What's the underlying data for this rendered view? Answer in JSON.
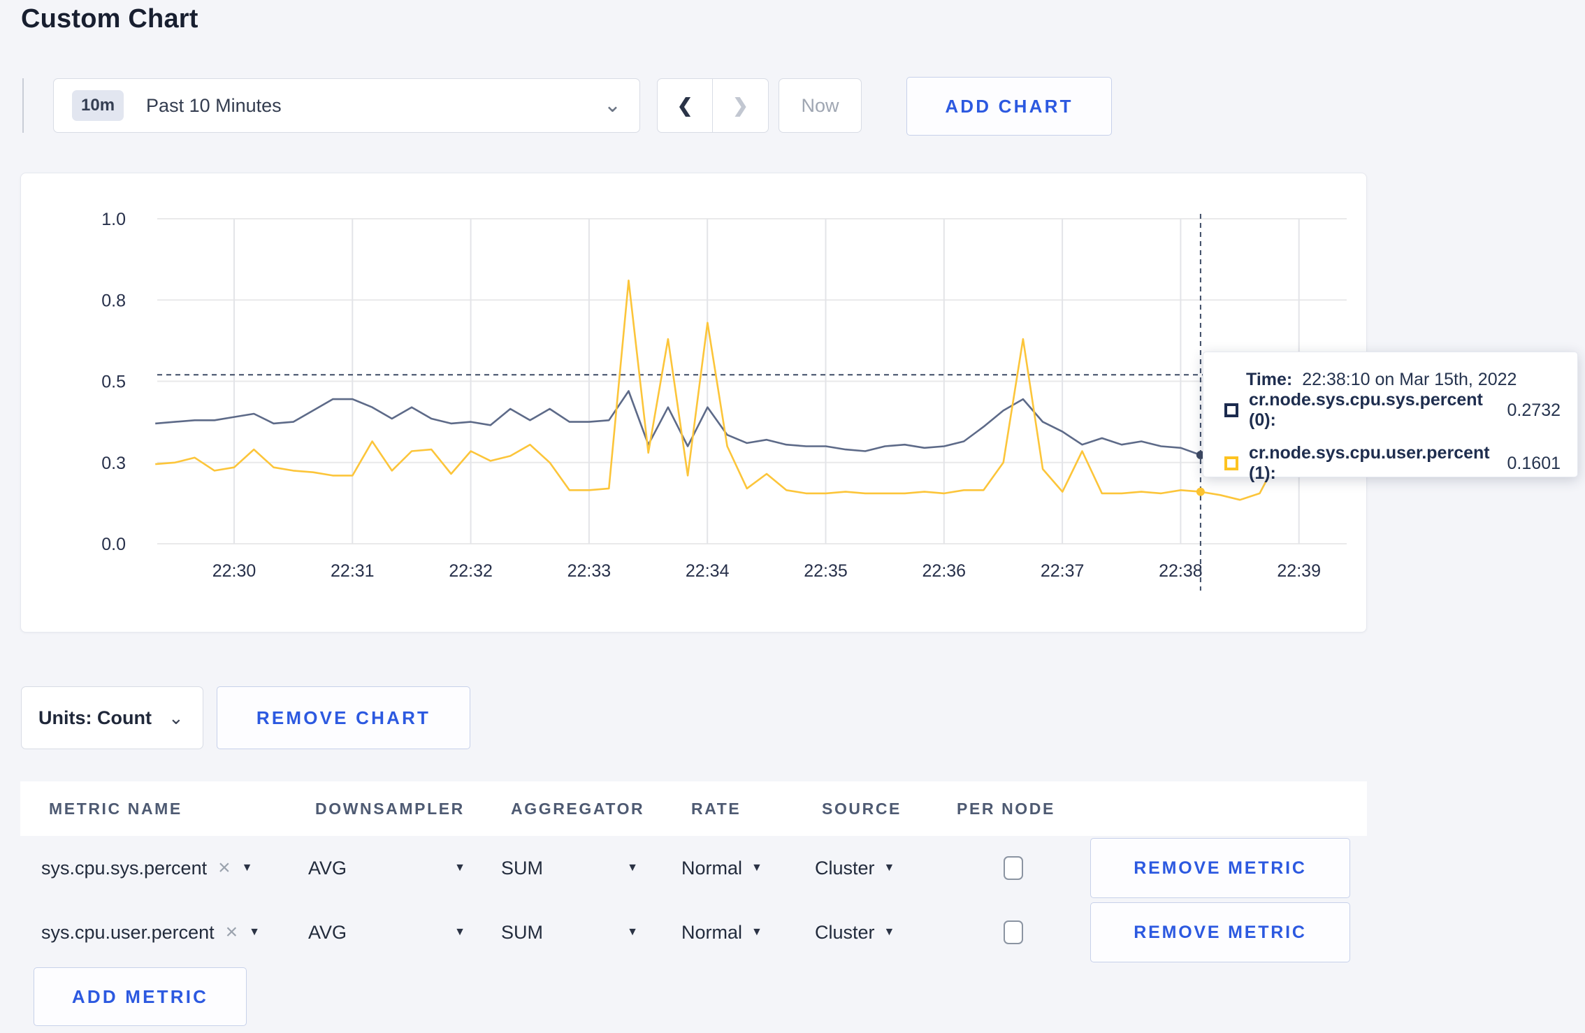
{
  "page_title": "Custom Chart",
  "icons": {
    "chevron_down": "⌄",
    "chevron_left": "❮",
    "chevron_right": "❯",
    "caret_down": "▼",
    "close": "×"
  },
  "toolbar": {
    "time_scale_badge": "10m",
    "time_scale_label": "Past 10 Minutes",
    "now_label": "Now",
    "add_chart_label": "ADD CHART"
  },
  "chart_data": {
    "type": "line",
    "title": "",
    "xlabel": "",
    "ylabel": "",
    "ylim": [
      0,
      1
    ],
    "grid": true,
    "legend_position": "tooltip",
    "y_ticks": [
      {
        "value": 0,
        "label": "0.0"
      },
      {
        "value": 0.25,
        "label": "0.3"
      },
      {
        "value": 0.5,
        "label": "0.5"
      },
      {
        "value": 0.75,
        "label": "0.8"
      },
      {
        "value": 1,
        "label": "1.0"
      }
    ],
    "x_ticks": [
      "22:30",
      "22:31",
      "22:32",
      "22:33",
      "22:34",
      "22:35",
      "22:36",
      "22:37",
      "22:38",
      "22:39"
    ],
    "x_start": "22:29:20",
    "x_interval_seconds": 10,
    "series": [
      {
        "name": "cr.node.sys.cpu.sys.percent (0)",
        "color": "#5d6a88",
        "dot_color": "#3d4963",
        "values": [
          0.37,
          0.375,
          0.38,
          0.38,
          0.39,
          0.4,
          0.37,
          0.375,
          0.41,
          0.445,
          0.445,
          0.42,
          0.385,
          0.42,
          0.385,
          0.37,
          0.375,
          0.365,
          0.415,
          0.38,
          0.415,
          0.375,
          0.375,
          0.38,
          0.47,
          0.305,
          0.42,
          0.3,
          0.42,
          0.335,
          0.31,
          0.32,
          0.305,
          0.3,
          0.3,
          0.29,
          0.285,
          0.3,
          0.305,
          0.295,
          0.3,
          0.315,
          0.36,
          0.41,
          0.445,
          0.375,
          0.345,
          0.305,
          0.325,
          0.305,
          0.315,
          0.3,
          0.295,
          0.2732,
          0.285,
          0.3,
          0.325,
          0.3,
          0.305,
          0.29
        ]
      },
      {
        "name": "cr.node.sys.cpu.user.percent (1)",
        "color": "#fcc53a",
        "dot_color": "#fcc330",
        "values": [
          0.245,
          0.25,
          0.265,
          0.225,
          0.235,
          0.29,
          0.235,
          0.225,
          0.22,
          0.21,
          0.21,
          0.315,
          0.225,
          0.285,
          0.29,
          0.215,
          0.285,
          0.255,
          0.27,
          0.305,
          0.25,
          0.165,
          0.165,
          0.17,
          0.81,
          0.28,
          0.63,
          0.21,
          0.68,
          0.3,
          0.17,
          0.215,
          0.165,
          0.155,
          0.155,
          0.16,
          0.155,
          0.155,
          0.155,
          0.16,
          0.155,
          0.165,
          0.165,
          0.25,
          0.63,
          0.23,
          0.16,
          0.285,
          0.155,
          0.155,
          0.16,
          0.155,
          0.165,
          0.1601,
          0.15,
          0.135,
          0.155,
          0.27,
          0.235,
          0.28
        ]
      }
    ],
    "crosshair": {
      "time": "22:38:10",
      "x_index": 53,
      "hover_value": 0.52
    }
  },
  "tooltip": {
    "time_label": "Time:",
    "time_value": "22:38:10 on Mar 15th, 2022",
    "series": [
      {
        "label": "cr.node.sys.cpu.sys.percent (0):",
        "value": "0.2732",
        "color": "#1c2b4e"
      },
      {
        "label": "cr.node.sys.cpu.user.percent (1):",
        "value": "0.1601",
        "color": "#fdc320"
      }
    ]
  },
  "chart_controls": {
    "units_label": "Units: Count",
    "remove_chart_label": "REMOVE CHART",
    "add_metric_label": "ADD METRIC"
  },
  "metrics_table": {
    "headers": [
      "METRIC NAME",
      "DOWNSAMPLER",
      "AGGREGATOR",
      "RATE",
      "SOURCE",
      "PER NODE"
    ],
    "rows": [
      {
        "metric_name": "sys.cpu.sys.percent",
        "downsampler": "AVG",
        "aggregator": "SUM",
        "rate": "Normal",
        "source": "Cluster",
        "per_node_checked": false,
        "remove_label": "REMOVE METRIC"
      },
      {
        "metric_name": "sys.cpu.user.percent",
        "downsampler": "AVG",
        "aggregator": "SUM",
        "rate": "Normal",
        "source": "Cluster",
        "per_node_checked": false,
        "remove_label": "REMOVE METRIC"
      }
    ]
  },
  "colors": {
    "page_background": "#f4f5f9",
    "card_background": "#ffffff",
    "accent_blue": "#2c59e0",
    "series_sys": "#5d6a88",
    "series_user": "#fcc53a",
    "crosshair": "#3e4c66",
    "gridline": "#e9e9ea"
  }
}
